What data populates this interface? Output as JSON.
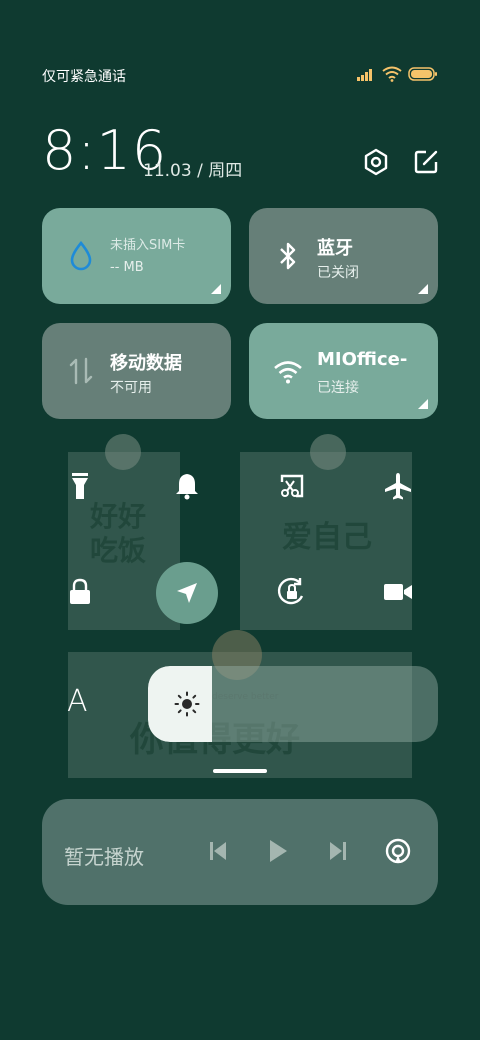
{
  "status_bar": {
    "text": "仅可紧急通话",
    "battery_color": "#f5c36a"
  },
  "header": {
    "time": "8:16",
    "date": "11.03 / 周四"
  },
  "tiles": [
    {
      "title": "未插入SIM卡",
      "subtitle": "-- MB",
      "icon": "water-drop-icon",
      "state": "on"
    },
    {
      "title": "蓝牙",
      "subtitle": "已关闭",
      "icon": "bluetooth-icon",
      "state": "off"
    },
    {
      "title": "移动数据",
      "subtitle": "不可用",
      "icon": "mobile-data-icon",
      "state": "off"
    },
    {
      "title": "MIOffice-",
      "subtitle": "已连接",
      "icon": "wifi-icon",
      "state": "on"
    }
  ],
  "wallpaper": {
    "sticker_left": "好好吃饭",
    "sticker_right": "爱自己",
    "sticker_bottom": "你值得更好",
    "sticker_bottom_sub": "deserve better"
  },
  "brightness": {
    "label": "A",
    "level_percent": 22
  },
  "media": {
    "label": "暂无播放"
  },
  "colors": {
    "background": "#0f3a30",
    "tile_on": "#79aa9b",
    "tile_off": "#667f78",
    "accent": "#6a9e8e"
  }
}
